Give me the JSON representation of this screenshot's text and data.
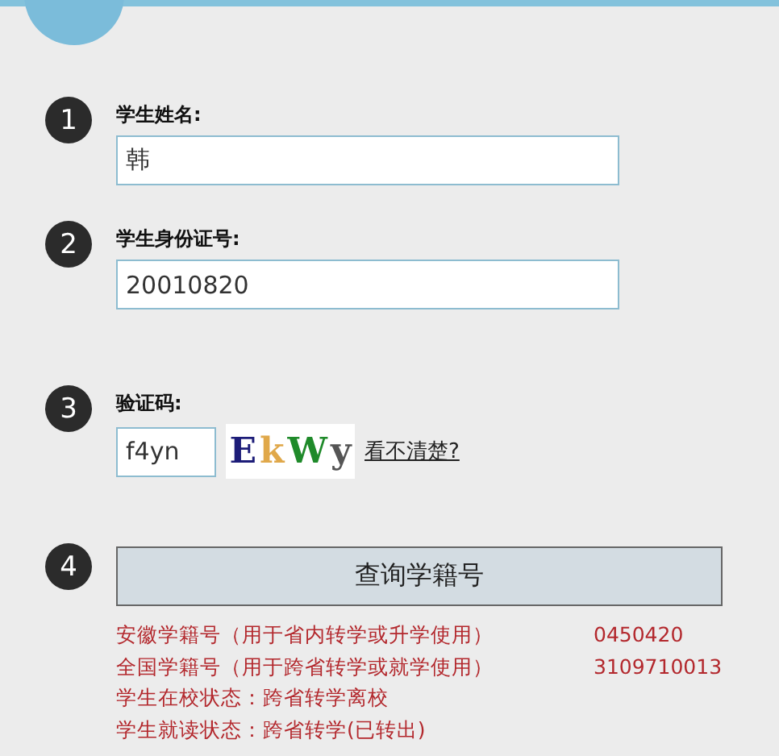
{
  "steps": [
    {
      "number": "1",
      "kind": "text",
      "label": "学生姓名:",
      "value": "韩"
    },
    {
      "number": "2",
      "kind": "text",
      "label": "学生身份证号:",
      "value": "20010820"
    },
    {
      "number": "3",
      "kind": "captcha",
      "label": "验证码:",
      "value": "f4yn",
      "captcha": [
        {
          "char": "E",
          "color": "#1c1c78"
        },
        {
          "char": "k",
          "color": "#e0a84a"
        },
        {
          "char": "W",
          "color": "#1f8a2a"
        },
        {
          "char": "y",
          "color": "#555555"
        }
      ],
      "link": "看不清楚?"
    },
    {
      "number": "4",
      "kind": "button",
      "button": "查询学籍号"
    }
  ],
  "results": [
    {
      "label": "安徽学籍号（用于省内转学或升学使用）",
      "value": "0450420"
    },
    {
      "label": "全国学籍号（用于跨省转学或就学使用）",
      "value": "3109710013"
    },
    {
      "label": "学生在校状态：跨省转学离校"
    },
    {
      "label": "学生就读状态：跨省转学(已转出)"
    }
  ]
}
